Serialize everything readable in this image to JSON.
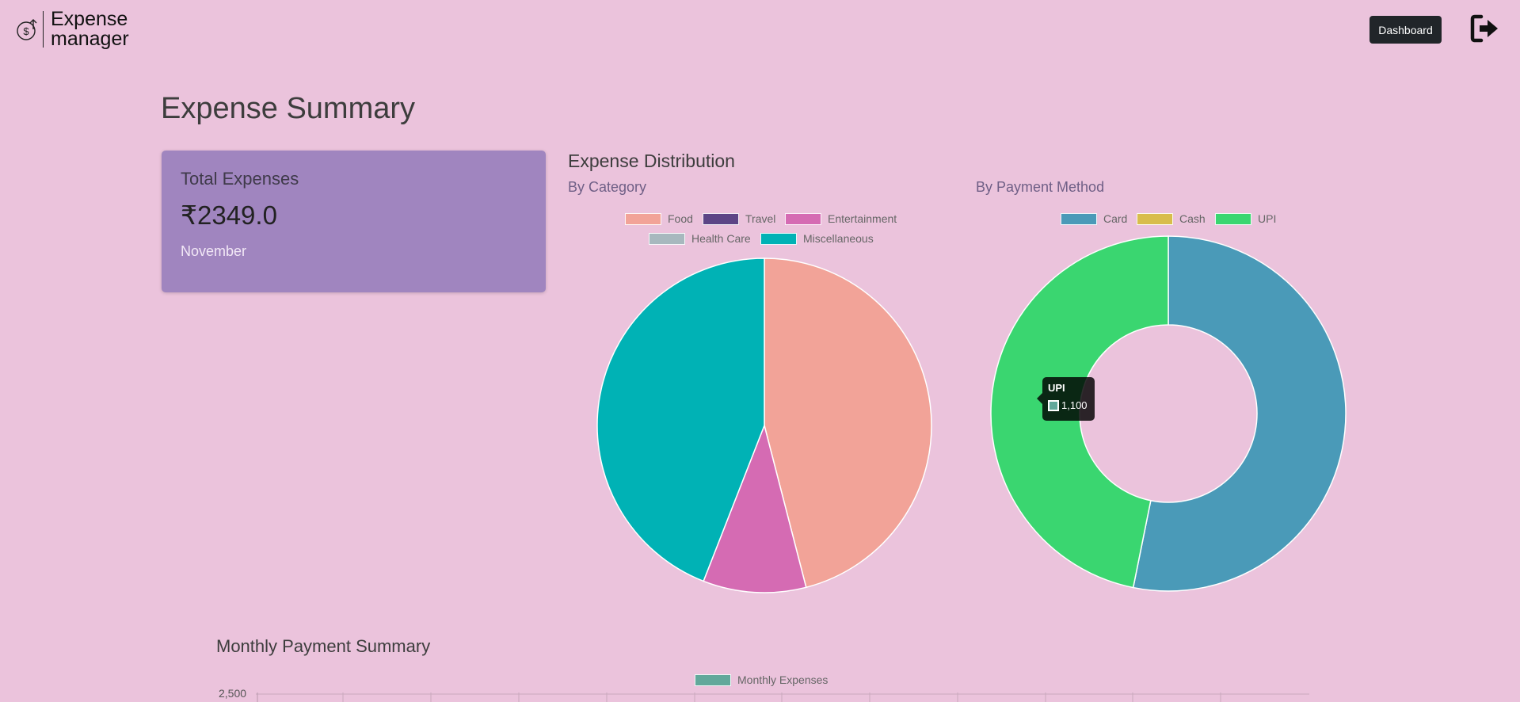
{
  "app": {
    "logo_line1": "Expense",
    "logo_line2": "manager",
    "logo_icon": "dollar-coin-arrow-icon"
  },
  "nav": {
    "dashboard_label": "Dashboard",
    "logout_icon": "logout-icon"
  },
  "page": {
    "title": "Expense Summary"
  },
  "total_card": {
    "label": "Total Expenses",
    "amount": "₹2349.0",
    "month": "November"
  },
  "distribution": {
    "title": "Expense Distribution",
    "by_category_title": "By Category",
    "by_payment_title": "By Payment Method"
  },
  "colors": {
    "background": "#ebc3dc",
    "card": "#a085bf",
    "Food": "#f2a398",
    "Travel": "#5c4586",
    "Entertainment": "#d56bb3",
    "Health Care": "#a7b8be",
    "Miscellaneous": "#00b2b5",
    "Card": "#4a9ab8",
    "Cash": "#d8bd4b",
    "UPI": "#3ad670",
    "Monthly Expenses": "#62a89b"
  },
  "chart_data": [
    {
      "type": "pie",
      "categories": [
        "Food",
        "Travel",
        "Entertainment",
        "Health Care",
        "Miscellaneous"
      ],
      "values": [
        1080,
        0,
        234,
        0,
        1035
      ]
    },
    {
      "type": "doughnut",
      "categories": [
        "Card",
        "Cash",
        "UPI"
      ],
      "values": [
        1249,
        0,
        1100
      ],
      "tooltip": {
        "label": "UPI",
        "value": "1,100"
      }
    },
    {
      "type": "bar",
      "title": "Monthly Payment Summary",
      "series": [
        {
          "name": "Monthly Expenses",
          "values": []
        }
      ],
      "y_ticks": [
        "2,500"
      ]
    }
  ]
}
